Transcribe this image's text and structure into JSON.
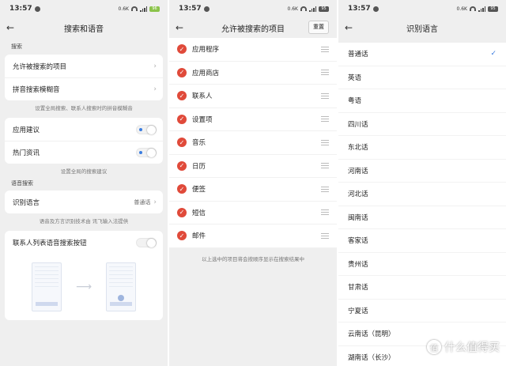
{
  "status_bar": {
    "time": "13:57",
    "speeds": [
      "0.6K",
      "0.6K",
      "0.6K"
    ],
    "battery": [
      "96",
      "95",
      "95"
    ]
  },
  "screen1": {
    "title": "搜索和语音",
    "section_search": "搜索",
    "rows": [
      "允许被搜索的项目",
      "拼音搜索模糊音"
    ],
    "hint1": "设置全局搜索、联系人搜索时的拼音模糊音",
    "toggles": [
      "应用建议",
      "热门资讯"
    ],
    "hint2": "设置全局的搜索建议",
    "section_voice": "语音搜索",
    "lang_row": "识别语言",
    "lang_value": "普通话",
    "hint3": "语音及方言识别技术由 讯飞输入法提供",
    "contacts_voice": "联系人列表语音搜索按钮"
  },
  "screen2": {
    "title": "允许被搜索的项目",
    "reset_label": "重置",
    "items": [
      "应用程序",
      "应用商店",
      "联系人",
      "设置项",
      "音乐",
      "日历",
      "便签",
      "短信",
      "邮件"
    ],
    "hint": "以上选中的项目将会按顺序显示在搜索结果中"
  },
  "screen3": {
    "title": "识别语言",
    "languages": [
      "普通话",
      "英语",
      "粤语",
      "四川话",
      "东北话",
      "河南话",
      "河北话",
      "闽南话",
      "客家话",
      "贵州话",
      "甘肃话",
      "宁夏话",
      "云南话（昆明）",
      "湖南话（长沙）"
    ],
    "selected": "普通话"
  },
  "watermark": "什么值得买",
  "colors": {
    "check_red": "#e04a3a",
    "accent_blue": "#3b7de0",
    "background": "#efefef"
  }
}
